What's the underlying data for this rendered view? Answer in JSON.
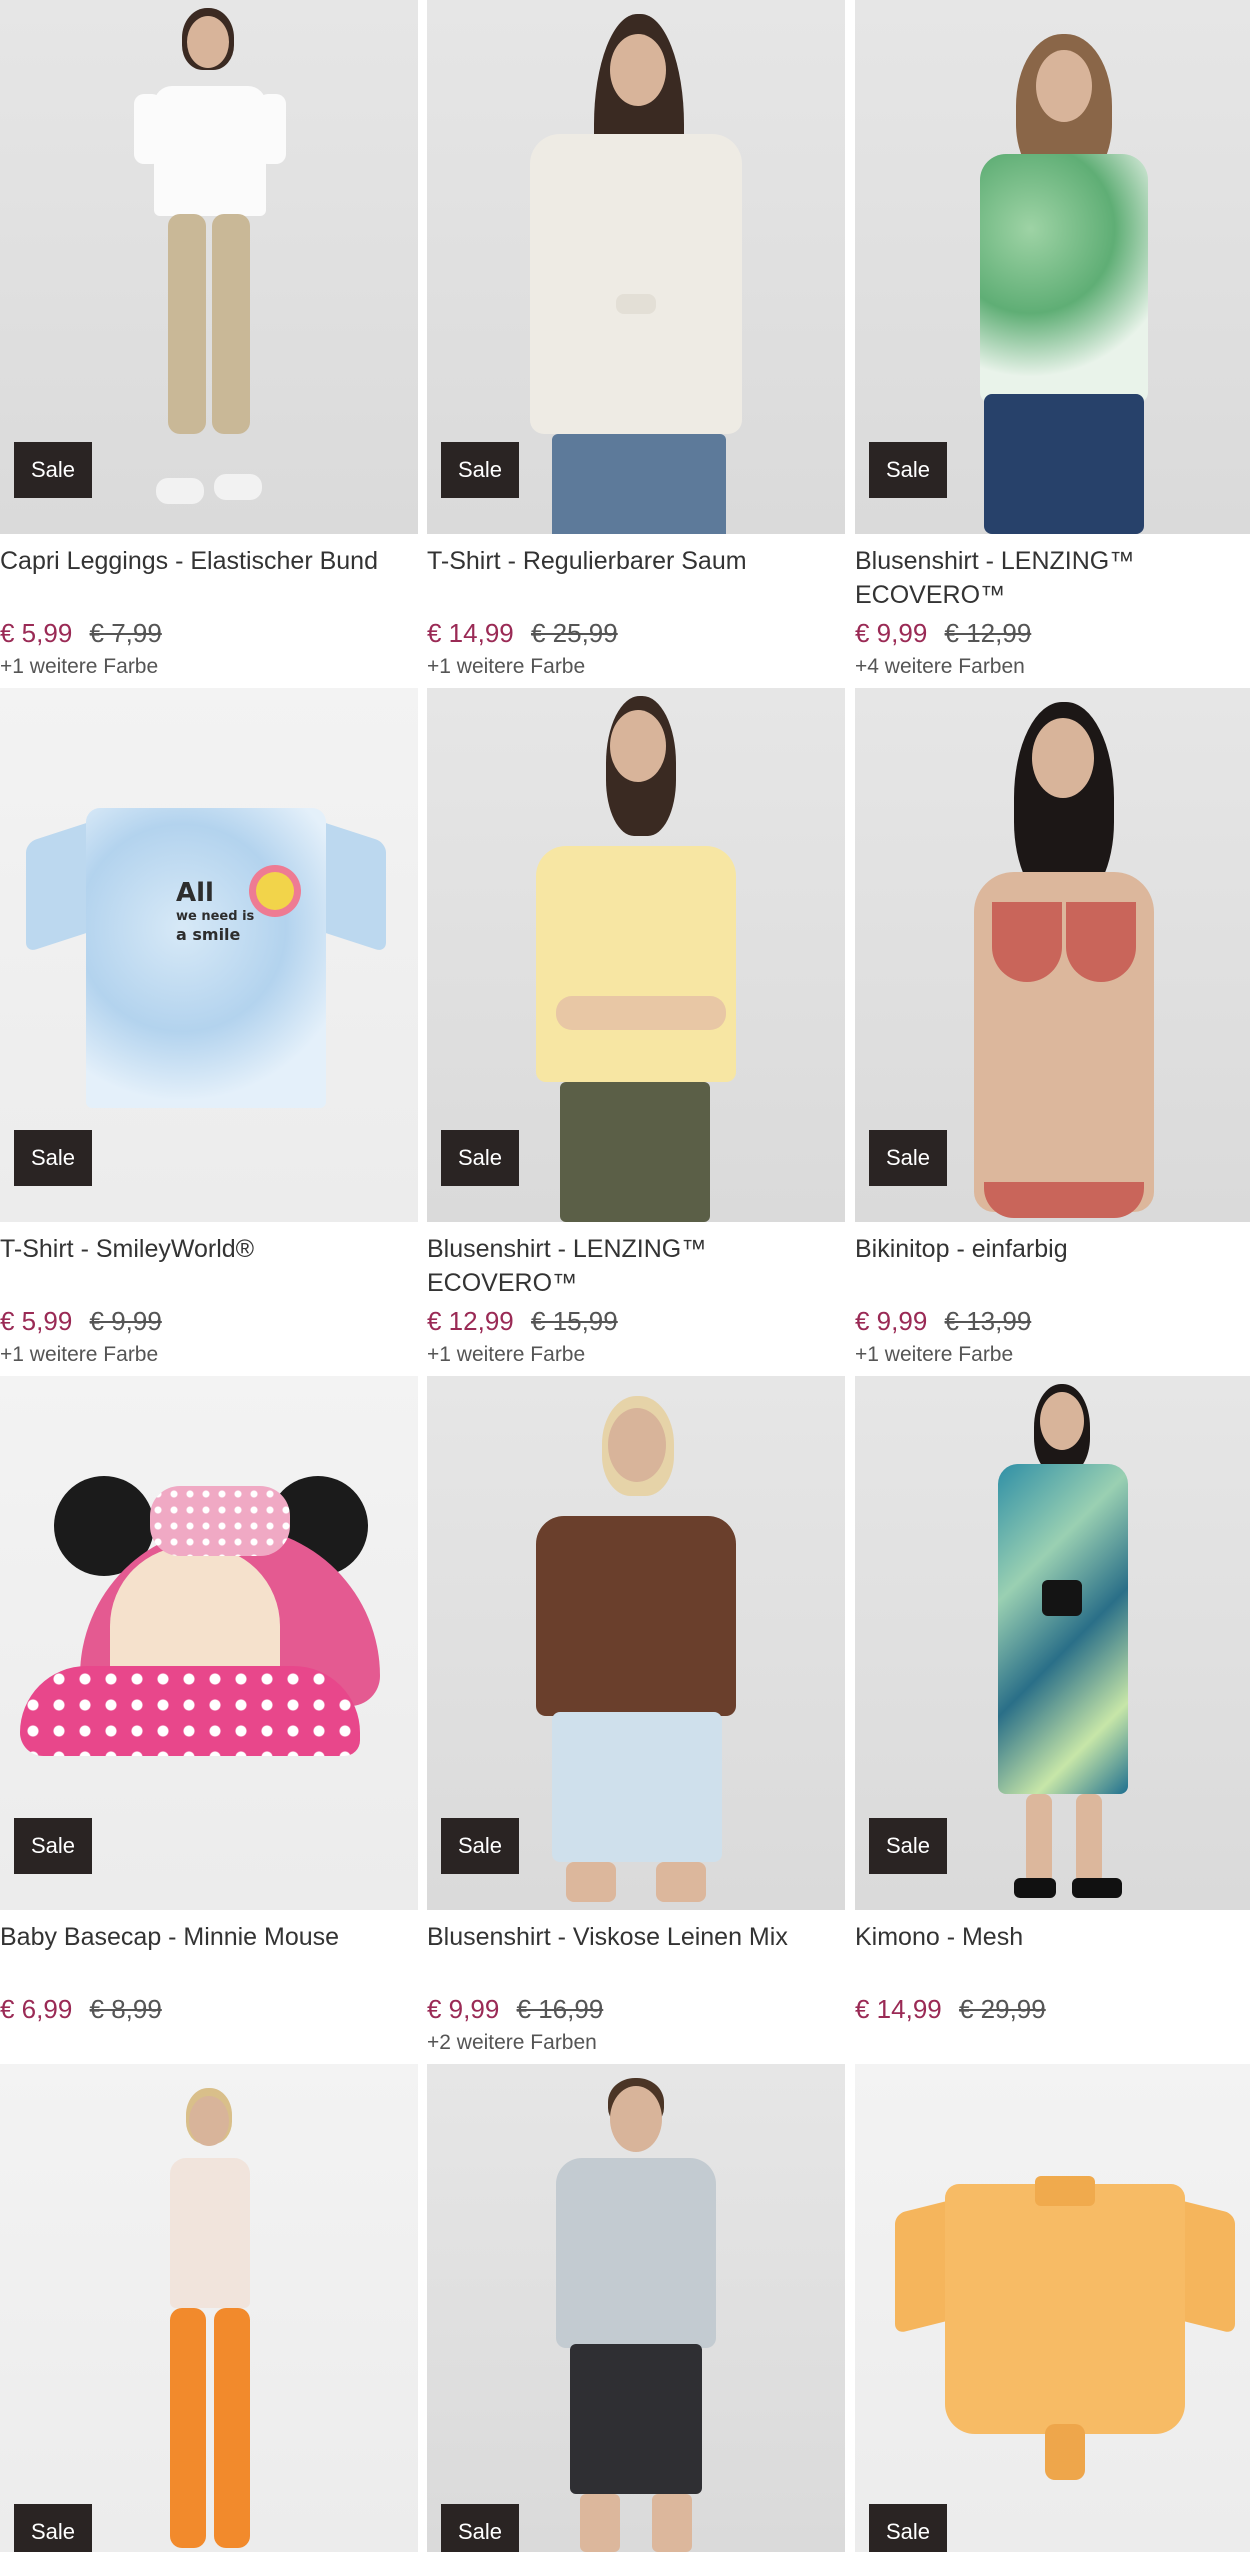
{
  "products": [
    {
      "title": "Capri Leggings - Elastischer Bund",
      "badge": "Sale",
      "price": "€ 5,99",
      "old_price": "€ 7,99",
      "colors": "+1 weitere Farbe"
    },
    {
      "title": "T-Shirt - Regulierbarer Saum",
      "badge": "Sale",
      "price": "€ 14,99",
      "old_price": "€ 25,99",
      "colors": "+1 weitere Farbe"
    },
    {
      "title": "Blusenshirt - LENZING™ ECOVERO™",
      "badge": "Sale",
      "price": "€ 9,99",
      "old_price": "€ 12,99",
      "colors": "+4 weitere Farben"
    },
    {
      "title": "T-Shirt - SmileyWorld®",
      "badge": "Sale",
      "price": "€ 5,99",
      "old_price": "€ 9,99",
      "colors": "+1 weitere Farbe"
    },
    {
      "title": "Blusenshirt - LENZING™ ECOVERO™",
      "badge": "Sale",
      "price": "€ 12,99",
      "old_price": "€ 15,99",
      "colors": "+1 weitere Farbe"
    },
    {
      "title": "Bikinitop - einfarbig",
      "badge": "Sale",
      "price": "€ 9,99",
      "old_price": "€ 13,99",
      "colors": "+1 weitere Farbe"
    },
    {
      "title": "Baby Basecap - Minnie Mouse",
      "badge": "Sale",
      "price": "€ 6,99",
      "old_price": "€ 8,99",
      "colors": ""
    },
    {
      "title": "Blusenshirt - Viskose Leinen Mix",
      "badge": "Sale",
      "price": "€ 9,99",
      "old_price": "€ 16,99",
      "colors": "+2 weitere Farben"
    },
    {
      "title": "Kimono - Mesh",
      "badge": "Sale",
      "price": "€ 14,99",
      "old_price": "€ 29,99",
      "colors": ""
    },
    {
      "badge": "Sale"
    },
    {
      "badge": "Sale"
    },
    {
      "badge": "Sale"
    }
  ],
  "tshirt_print": {
    "line1": "All",
    "line2": "we need is",
    "line3": "a smile"
  },
  "colors": {
    "sale_price": "#9a2a55",
    "badge_bg": "#2a2423"
  }
}
